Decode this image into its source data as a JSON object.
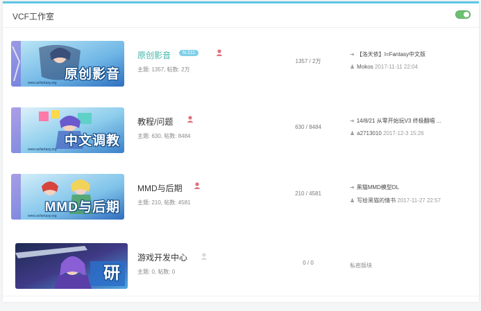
{
  "panel": {
    "title": "VCF工作室",
    "toggle_on": true,
    "accent_color": "#5cc6e4"
  },
  "forums": [
    {
      "banner_text": "原创影音",
      "banner_url": "www.acfantasy.org",
      "name": "原创影音",
      "badge": "N 211",
      "stats": "主题: 1357, 帖数: 2万",
      "counts": "1357 / 2万",
      "last_title": "【洛天依】I=Fantasy中文版",
      "last_user": "Mokos",
      "last_date": "2017-11-11 22:04",
      "moderator_icon": "user-icon"
    },
    {
      "banner_text": "中文调教",
      "banner_url": "www.acfantasy.org",
      "name": "教程/问题",
      "stats": "主题: 630, 帖数: 8484",
      "counts": "630 / 8484",
      "last_title": "14/8/21 从零开始玩V3 终极翻唱 ...",
      "last_user": "a2713010",
      "last_date": "2017-12-3 15:26",
      "moderator_icon": "user-icon"
    },
    {
      "banner_text": "MMD与后期",
      "banner_url": "www.acfantasy.org",
      "name": "MMD与后期",
      "stats": "主题: 210, 帖数: 4581",
      "counts": "210 / 4581",
      "last_title": "黑猫MMD模型DL",
      "last_user": "写给黑猫的情书",
      "last_date": "2017-11-27 22:57",
      "moderator_icon": "user-icon"
    },
    {
      "banner_text": "研",
      "name": "游戏开发中心",
      "stats": "主题: 0, 帖数: 0",
      "counts": "0 / 0",
      "private_text": "私密版块",
      "moderator_icon": "user-icon"
    }
  ]
}
